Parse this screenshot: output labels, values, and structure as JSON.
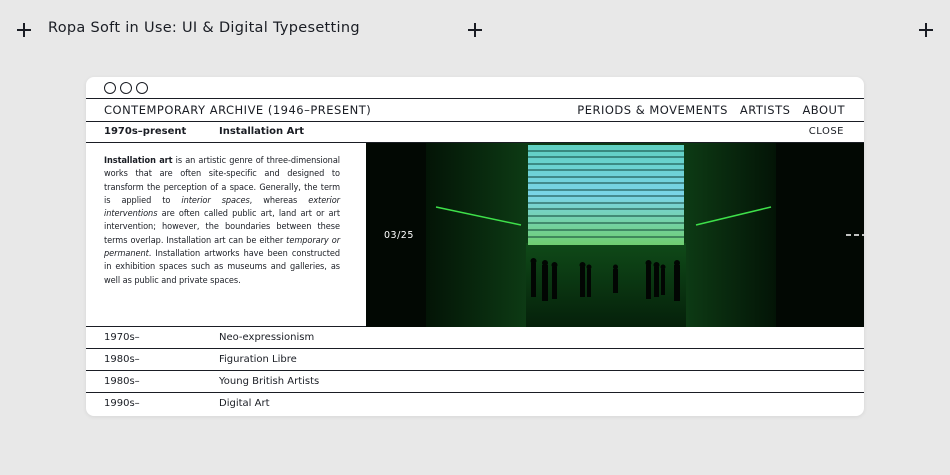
{
  "page": {
    "title": "Ropa Soft in Use: UI & Digital Typesetting"
  },
  "nav": {
    "site_title": "CONTEMPORARY ARCHIVE (1946–PRESENT)",
    "menu": [
      "PERIODS & MOVEMENTS",
      "ARTISTS",
      "ABOUT"
    ]
  },
  "detail": {
    "period": "1970s–present",
    "movement": "Installation Art",
    "close_label": "CLOSE",
    "description": [
      {
        "text": "Installation art",
        "style": "bold"
      },
      {
        "text": " is an artistic genre of three-dimensional works that are often site-specific and designed to transform the perception of a space. Generally, the term is applied to ",
        "style": "normal"
      },
      {
        "text": "interior spaces",
        "style": "italic"
      },
      {
        "text": ", whereas ",
        "style": "normal"
      },
      {
        "text": "exterior interventions",
        "style": "italic"
      },
      {
        "text": " are often called public art, land art or art intervention; however, the boundaries between these terms overlap. Installation art can be either ",
        "style": "normal"
      },
      {
        "text": "temporary or permanent",
        "style": "italic"
      },
      {
        "text": ". Installation artworks have been constructed in exhibition spaces such as museums and galleries, as well as public and private spaces.",
        "style": "normal"
      }
    ],
    "image_counter": "03/25",
    "next_icon": "arrow-right-icon"
  },
  "list": [
    {
      "period": "1970s–",
      "name": "Neo-expressionism"
    },
    {
      "period": "1980s–",
      "name": "Figuration Libre"
    },
    {
      "period": "1980s–",
      "name": "Young British Artists"
    },
    {
      "period": "1990s–",
      "name": "Digital Art"
    }
  ],
  "colors": {
    "background": "#e8e8e8",
    "ink": "#1a1d24",
    "panel": "#ffffff",
    "gallery_green": "#1f6b2a"
  }
}
